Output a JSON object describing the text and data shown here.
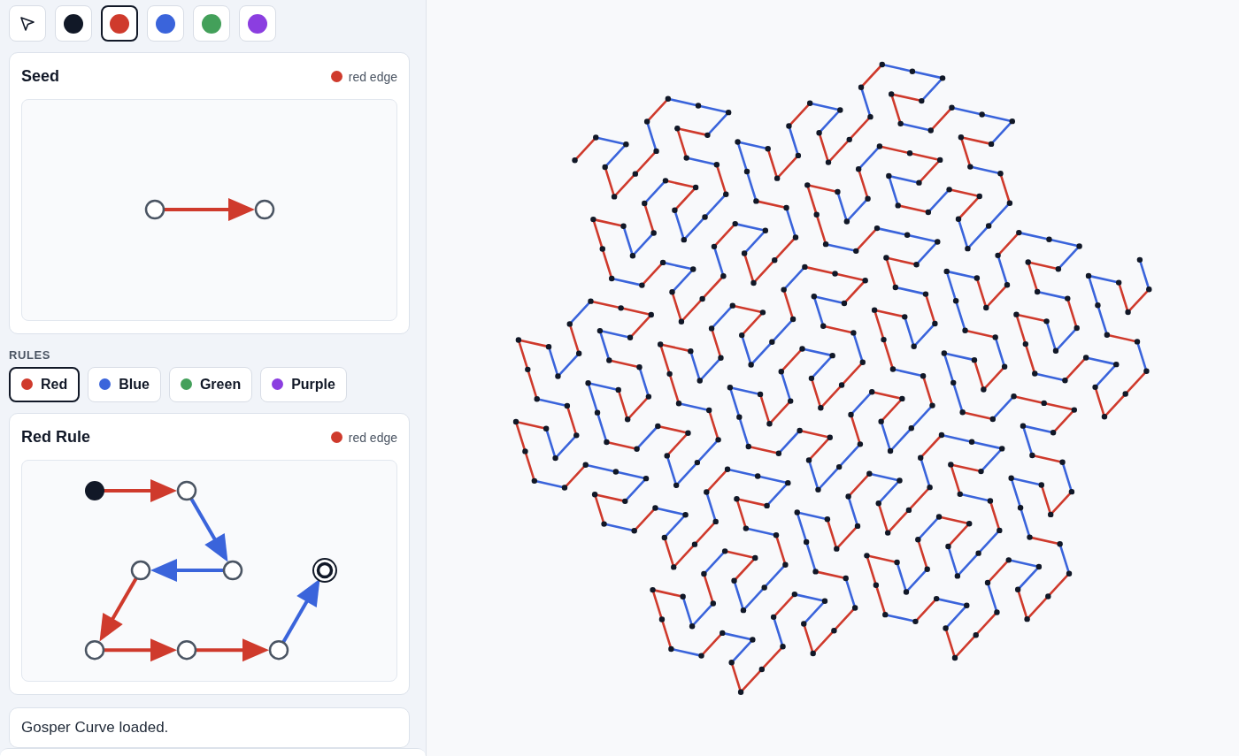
{
  "toolbar": [
    {
      "kind": "pointer",
      "selected": false
    },
    {
      "kind": "color",
      "color": "#111827",
      "selected": false
    },
    {
      "kind": "color",
      "color": "#cf3a2c",
      "selected": true
    },
    {
      "kind": "color",
      "color": "#3a64db",
      "selected": false
    },
    {
      "kind": "color",
      "color": "#43a05a",
      "selected": false
    },
    {
      "kind": "color",
      "color": "#8b3ee0",
      "selected": false
    }
  ],
  "seed": {
    "title": "Seed",
    "legend": {
      "label": "red edge",
      "color": "#cf3a2c"
    },
    "nodes": [
      {
        "kind": "open"
      },
      {
        "kind": "open"
      }
    ],
    "edges": [
      {
        "color": "#cf3a2c"
      }
    ]
  },
  "rules_heading": "RULES",
  "rule_tabs": [
    {
      "label": "Red",
      "color": "#cf3a2c",
      "selected": true
    },
    {
      "label": "Blue",
      "color": "#3a64db",
      "selected": false
    },
    {
      "label": "Green",
      "color": "#43a05a",
      "selected": false
    },
    {
      "label": "Purple",
      "color": "#8b3ee0",
      "selected": false
    }
  ],
  "rule": {
    "title": "Red Rule",
    "legend": {
      "label": "red edge",
      "color": "#cf3a2c"
    },
    "nodes": [
      {
        "kind": "start"
      },
      {
        "kind": "open"
      },
      {
        "kind": "open"
      },
      {
        "kind": "open"
      },
      {
        "kind": "open"
      },
      {
        "kind": "open"
      },
      {
        "kind": "open"
      },
      {
        "kind": "end"
      }
    ],
    "edges": [
      {
        "color": "#cf3a2c"
      },
      {
        "color": "#3a64db"
      },
      {
        "color": "#3a64db"
      },
      {
        "color": "#cf3a2c"
      },
      {
        "color": "#cf3a2c"
      },
      {
        "color": "#cf3a2c"
      },
      {
        "color": "#3a64db"
      }
    ]
  },
  "status": "Gosper Curve loaded."
}
